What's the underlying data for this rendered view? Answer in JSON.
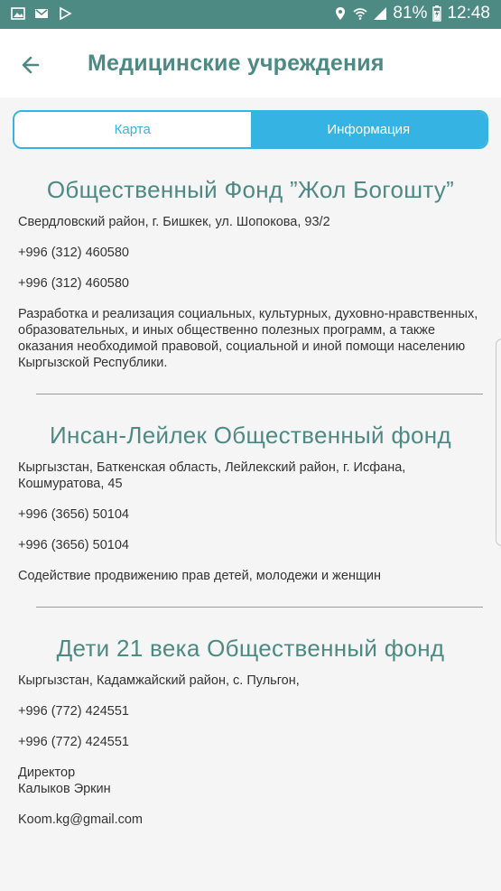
{
  "status_bar": {
    "battery": "81%",
    "time": "12:48",
    "left_icons": [
      "gallery-icon",
      "gmail-icon",
      "play-store-icon"
    ],
    "right_icons": [
      "location-icon",
      "wifi-icon",
      "signal-icon",
      "battery-charging-icon"
    ]
  },
  "app_bar": {
    "title": "Медицинские учреждения"
  },
  "tabs": {
    "map": "Карта",
    "info": "Информация",
    "active": "info"
  },
  "colors": {
    "primary": "#4e8a84",
    "accent": "#35b4e3"
  },
  "orgs": [
    {
      "name": "Общественный Фонд ”Жол Богошту”",
      "address": "Свердловский район,  г. Бишкек, ул. Шопокова, 93/2",
      "phone1": "+996 (312) 460580",
      "phone2": "+996 (312) 460580",
      "description": "Разработка и реализация социальных, культурных, духовно-нравственных, образовательных, и иных общественно полезных программ, а также оказания необходимой правовой, социальной и иной помощи населению Кыргызской Республики."
    },
    {
      "name": "Инсан-Лейлек Общественный фонд",
      "address": "Кыргызстан, Баткенская область, Лейлекский район,  г. Исфана, Кошмуратова, 45",
      "phone1": "+996 (3656) 50104",
      "phone2": "+996 (3656) 50104",
      "description": "Содействие продвижению прав детей, молодежи и женщин"
    },
    {
      "name": "Дети 21 века Общественный фонд",
      "address": "Кыргызстан, Кадамжайский район,  с. Пульгон,",
      "phone1": "+996 (772) 424551",
      "phone2": "+996 (772) 424551",
      "contact_role": "Директор",
      "contact_name": "Калыков Эркин",
      "email": "Koom.kg@gmail.com"
    }
  ]
}
